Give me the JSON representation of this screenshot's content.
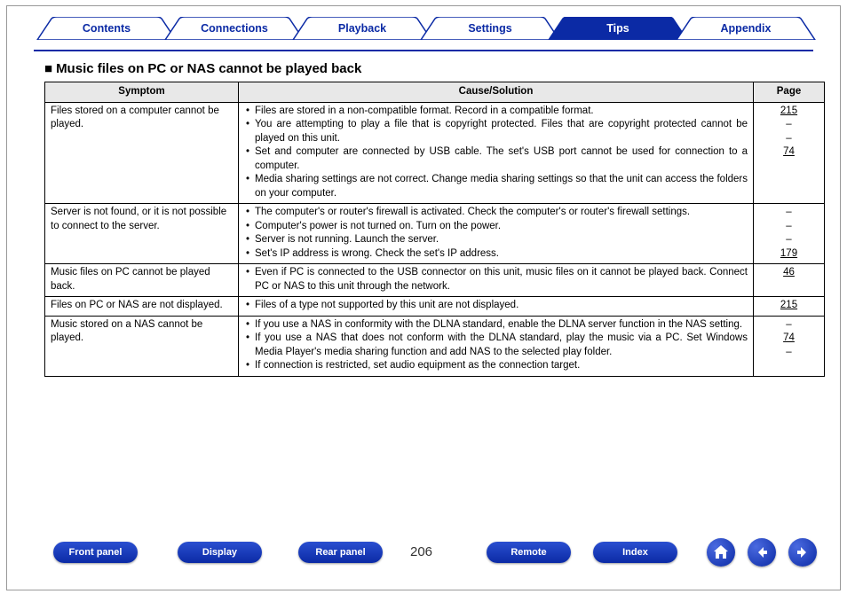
{
  "tabs": {
    "items": [
      {
        "label": "Contents",
        "active": false
      },
      {
        "label": "Connections",
        "active": false
      },
      {
        "label": "Playback",
        "active": false
      },
      {
        "label": "Settings",
        "active": false
      },
      {
        "label": "Tips",
        "active": true
      },
      {
        "label": "Appendix",
        "active": false
      }
    ]
  },
  "heading": "Music files on PC or NAS cannot be played back",
  "table": {
    "headers": {
      "symptom": "Symptom",
      "cause": "Cause/Solution",
      "page": "Page"
    },
    "rows": [
      {
        "symptom": "Files stored on a computer cannot be played.",
        "causes": [
          "Files are stored in a non-compatible format. Record in a compatible format.",
          "You are attempting to play a file that is copyright protected. Files that are copyright protected cannot be played on this unit.",
          "Set and computer are connected by USB cable. The set's USB port cannot be used for connection to a computer.",
          "Media sharing settings are not correct. Change media sharing settings so that the unit can access the folders on your computer."
        ],
        "pages": [
          "215",
          "–",
          "–",
          "74"
        ]
      },
      {
        "symptom": "Server is not found, or it is not possible to connect to the server.",
        "causes": [
          "The computer's or router's firewall is activated. Check the computer's or router's firewall settings.",
          "Computer's power is not turned on. Turn on the power.",
          "Server is not running. Launch the server.",
          "Set's IP address is wrong. Check the set's IP address."
        ],
        "pages": [
          "–",
          "–",
          "–",
          "179"
        ]
      },
      {
        "symptom": "Music files on PC cannot be played back.",
        "causes": [
          "Even if PC is connected to the USB connector on this unit, music files on it cannot be played back. Connect PC or NAS to this unit through the network."
        ],
        "pages": [
          "46"
        ]
      },
      {
        "symptom": "Files on PC or NAS are not displayed.",
        "causes": [
          "Files of a type not supported by this unit are not displayed."
        ],
        "pages": [
          "215"
        ]
      },
      {
        "symptom": "Music stored on a NAS cannot be played.",
        "causes": [
          "If you use a NAS in conformity with the DLNA standard, enable the DLNA server function in the NAS setting.",
          "If you use a NAS that does not conform with the DLNA standard, play the music via a PC. Set Windows Media Player's media sharing function and add NAS to the selected play folder.",
          "If connection is restricted, set audio equipment as the connection target."
        ],
        "pages": [
          "–",
          "74",
          "–"
        ]
      }
    ]
  },
  "footer": {
    "buttons": {
      "front_panel": "Front panel",
      "display": "Display",
      "rear_panel": "Rear panel",
      "remote": "Remote",
      "index": "Index"
    },
    "page_number": "206"
  }
}
